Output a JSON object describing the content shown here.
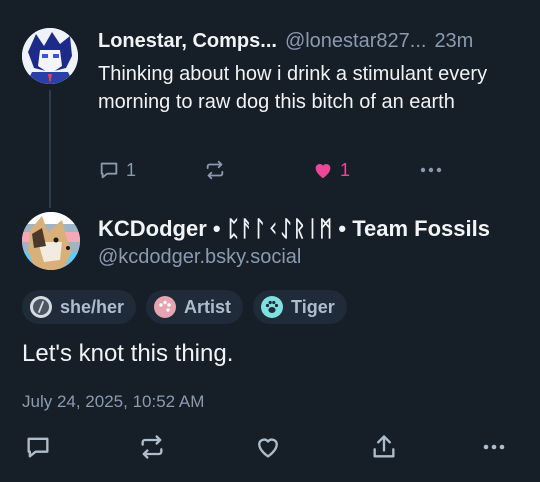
{
  "parent_post": {
    "display_name": "Lonestar, Comps...",
    "handle": "@lonestar827...",
    "timestamp": "23m",
    "text": "Thinking about how i drink a stimulant every morning to raw dog this bitch of an earth",
    "reply_count": "1",
    "like_count": "1",
    "liked": true
  },
  "main_post": {
    "display_name": "KCDodger • ᛈᚨᛚᚲᛇᚱᛁᛗ • Team Fossils",
    "handle": "@kcdodger.bsky.social",
    "labels": [
      {
        "text": "she/her",
        "icon": "slash-circle-icon"
      },
      {
        "text": "Artist",
        "icon": "palette-icon"
      },
      {
        "text": "Tiger",
        "icon": "paw-icon"
      }
    ],
    "text": "Let's knot this thing.",
    "timestamp": "July 24, 2025, 10:52 AM"
  },
  "colors": {
    "background": "#161e27",
    "muted_text": "#8a9bb0",
    "like_pink": "#ec4899",
    "pill_bg": "#1f2b38"
  }
}
